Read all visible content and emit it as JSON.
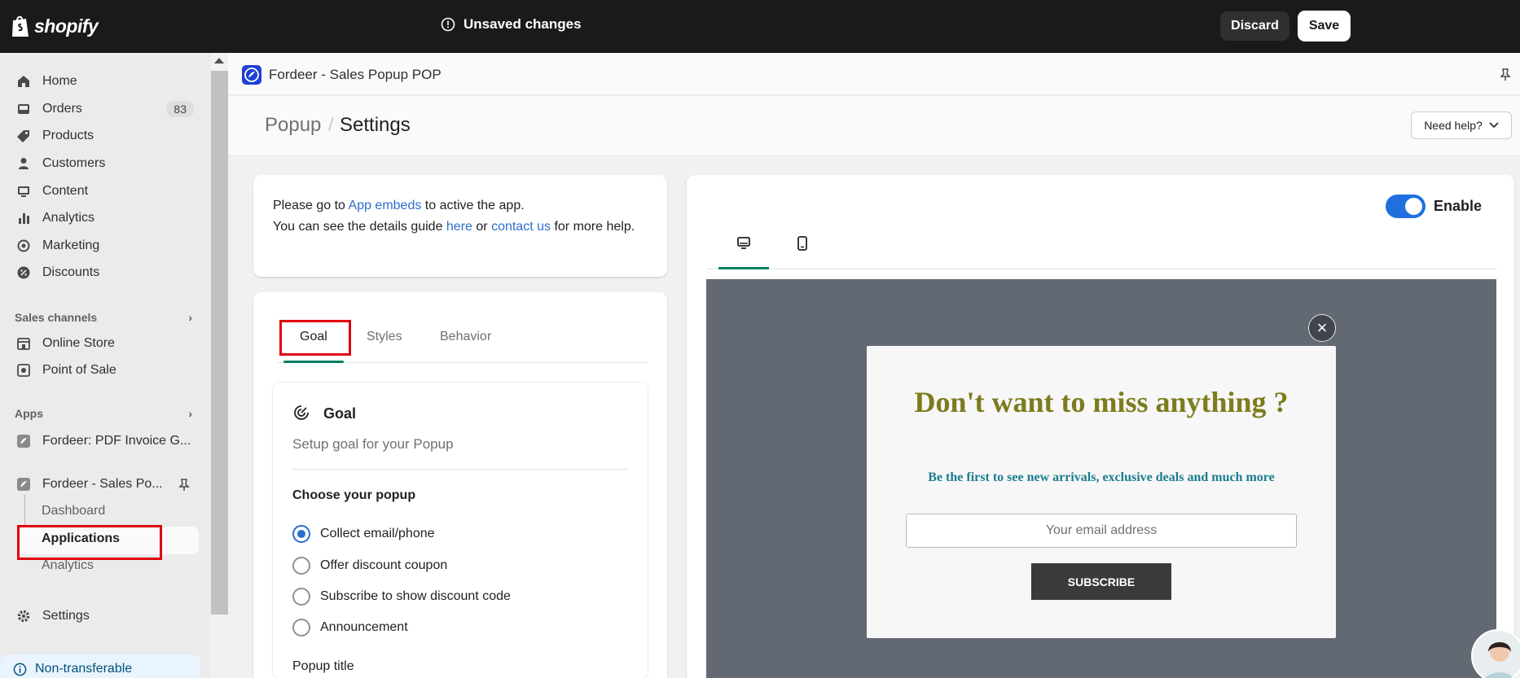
{
  "topbar": {
    "logo_text": "shopify",
    "unsaved_label": "Unsaved changes",
    "discard_label": "Discard",
    "save_label": "Save"
  },
  "sidebar": {
    "items": [
      {
        "label": "Home",
        "icon": "home-icon"
      },
      {
        "label": "Orders",
        "icon": "inbox-icon",
        "badge": "83"
      },
      {
        "label": "Products",
        "icon": "tag-icon"
      },
      {
        "label": "Customers",
        "icon": "person-icon"
      },
      {
        "label": "Content",
        "icon": "content-icon"
      },
      {
        "label": "Analytics",
        "icon": "bar-chart-icon"
      },
      {
        "label": "Marketing",
        "icon": "target-icon"
      },
      {
        "label": "Discounts",
        "icon": "discount-icon"
      }
    ],
    "sales_channels_heading": "Sales channels",
    "sales_channels": [
      {
        "label": "Online Store",
        "icon": "store-icon"
      },
      {
        "label": "Point of Sale",
        "icon": "pos-icon"
      }
    ],
    "apps_heading": "Apps",
    "apps": [
      {
        "label": "Fordeer: PDF Invoice G..."
      },
      {
        "label": "Fordeer - Sales Po..."
      }
    ],
    "app_subitems": [
      "Dashboard",
      "Applications",
      "Analytics"
    ],
    "settings_label": "Settings",
    "non_transferable_label": "Non-transferable"
  },
  "app_header": {
    "title": "Fordeer - Sales Popup POP"
  },
  "page": {
    "breadcrumb": "Popup",
    "title": "Settings",
    "need_help": "Need help?"
  },
  "info_card": {
    "line1_pre": "Please go to ",
    "line1_link": "App embeds",
    "line1_post": " to active the app.",
    "line2_pre": "You can see the details guide ",
    "line2_link1": "here",
    "line2_mid": " or ",
    "line2_link2": "contact us",
    "line2_post": " for more help."
  },
  "tabs": [
    "Goal",
    "Styles",
    "Behavior"
  ],
  "goal_card": {
    "title": "Goal",
    "subtitle": "Setup goal for your Popup",
    "choose_heading": "Choose your popup",
    "options": [
      {
        "label": "Collect email/phone",
        "selected": true
      },
      {
        "label": "Offer discount coupon",
        "selected": false
      },
      {
        "label": "Subscribe to show discount code",
        "selected": false
      },
      {
        "label": "Announcement",
        "selected": false
      }
    ],
    "popup_title_label": "Popup title"
  },
  "preview": {
    "enable_label": "Enable",
    "enabled": true,
    "heading": "Don't want to miss anything ?",
    "subheading": "Be the first to see new arrivals, exclusive deals and much more",
    "email_placeholder": "Your email address",
    "subscribe_label": "SUBSCRIBE"
  },
  "colors": {
    "topbar": "#1a1a1a",
    "accent_green": "#008060",
    "link": "#2c6ecb",
    "toggle": "#1f6fde",
    "popup_heading": "#7c7c1e",
    "popup_sub": "#1b7d8e",
    "highlight": "#e0000f"
  }
}
